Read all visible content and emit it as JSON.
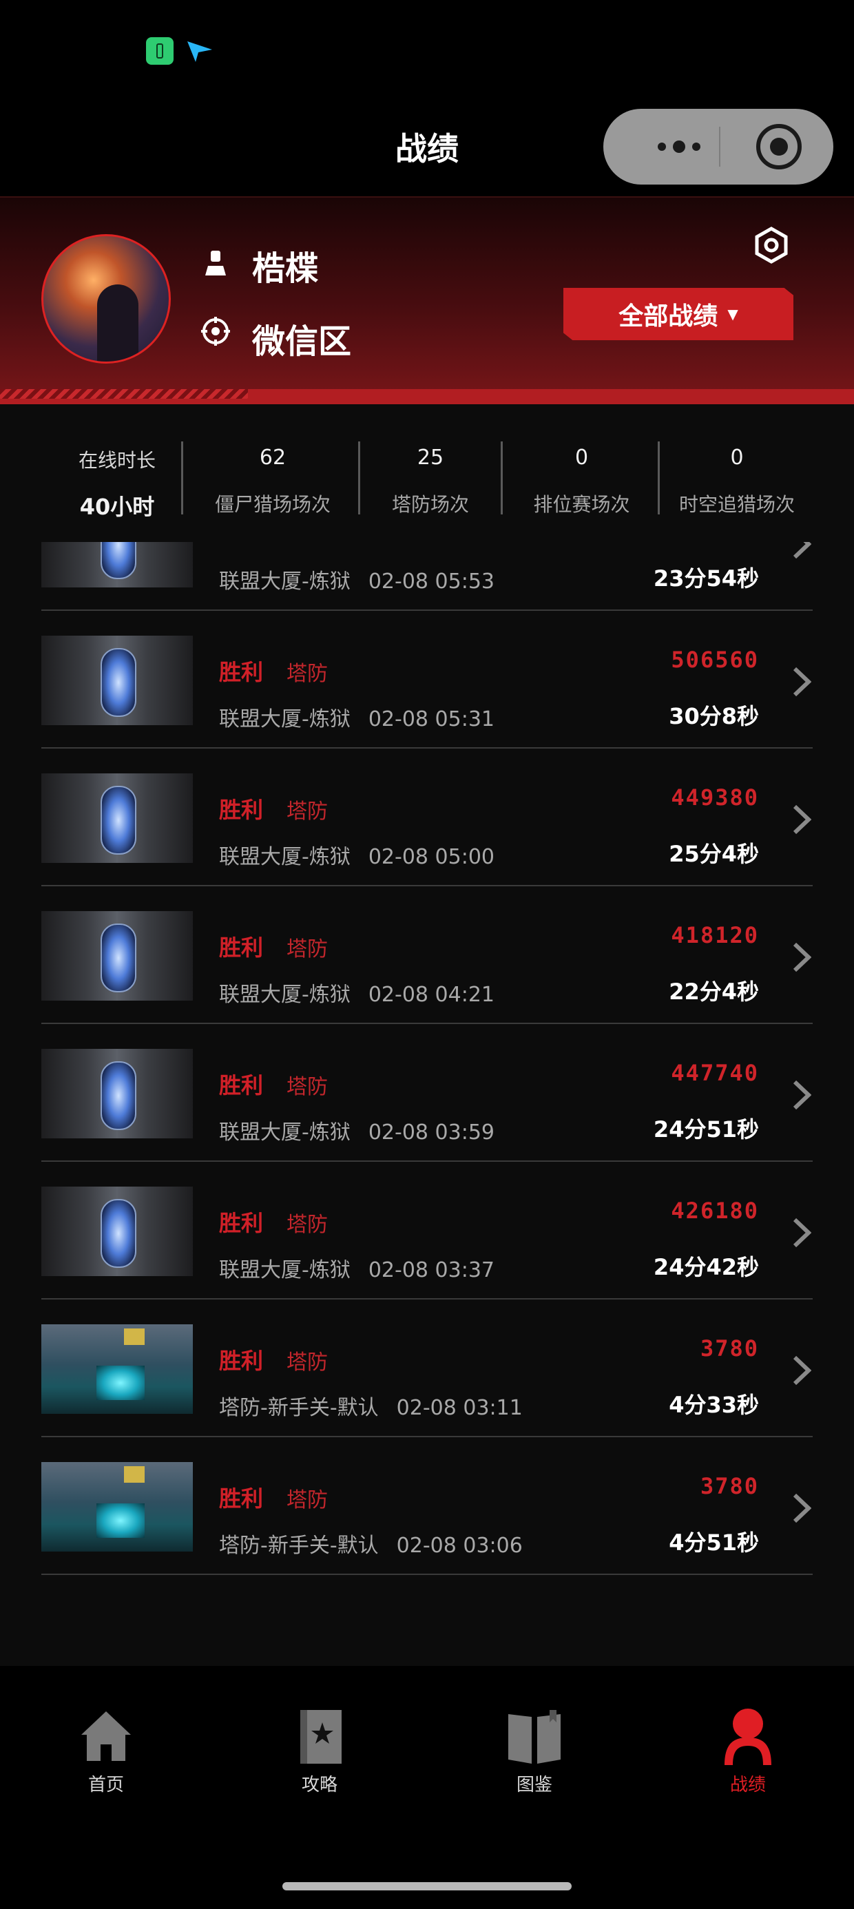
{
  "header": {
    "title": "战绩"
  },
  "profile": {
    "username": "梏楪",
    "zone": "微信区",
    "filter_label": "全部战绩",
    "filter_caret": "▼"
  },
  "stats": [
    {
      "value": "40小时",
      "label": "在线时长"
    },
    {
      "value": "62",
      "label": "僵尸猎场场次"
    },
    {
      "value": "25",
      "label": "塔防场次"
    },
    {
      "value": "0",
      "label": "排位赛场次"
    },
    {
      "value": "0",
      "label": "时空追猎场次"
    }
  ],
  "records": [
    {
      "result": "",
      "mode": "",
      "map": "联盟大厦-炼狱",
      "time": "02-08 05:53",
      "score": "",
      "duration": "23分54秒",
      "thumb": "dark"
    },
    {
      "result": "胜利",
      "mode": "塔防",
      "map": "联盟大厦-炼狱",
      "time": "02-08 05:31",
      "score": "506560",
      "duration": "30分8秒",
      "thumb": "dark"
    },
    {
      "result": "胜利",
      "mode": "塔防",
      "map": "联盟大厦-炼狱",
      "time": "02-08 05:00",
      "score": "449380",
      "duration": "25分4秒",
      "thumb": "dark"
    },
    {
      "result": "胜利",
      "mode": "塔防",
      "map": "联盟大厦-炼狱",
      "time": "02-08 04:21",
      "score": "418120",
      "duration": "22分4秒",
      "thumb": "dark"
    },
    {
      "result": "胜利",
      "mode": "塔防",
      "map": "联盟大厦-炼狱",
      "time": "02-08 03:59",
      "score": "447740",
      "duration": "24分51秒",
      "thumb": "dark"
    },
    {
      "result": "胜利",
      "mode": "塔防",
      "map": "联盟大厦-炼狱",
      "time": "02-08 03:37",
      "score": "426180",
      "duration": "24分42秒",
      "thumb": "dark"
    },
    {
      "result": "胜利",
      "mode": "塔防",
      "map": "塔防-新手关-默认",
      "time": "02-08 03:11",
      "score": "3780",
      "duration": "4分33秒",
      "thumb": "blue"
    },
    {
      "result": "胜利",
      "mode": "塔防",
      "map": "塔防-新手关-默认",
      "time": "02-08 03:06",
      "score": "3780",
      "duration": "4分51秒",
      "thumb": "blue"
    }
  ],
  "nav": {
    "items": [
      {
        "label": "首页",
        "icon": "home-icon"
      },
      {
        "label": "攻略",
        "icon": "guide-book-icon"
      },
      {
        "label": "图鉴",
        "icon": "open-book-icon"
      },
      {
        "label": "战绩",
        "icon": "user-profile-icon",
        "active": true
      }
    ]
  },
  "colors": {
    "accent": "#d0242a",
    "background": "#0c0c0c",
    "header_red": "#7a1619"
  }
}
